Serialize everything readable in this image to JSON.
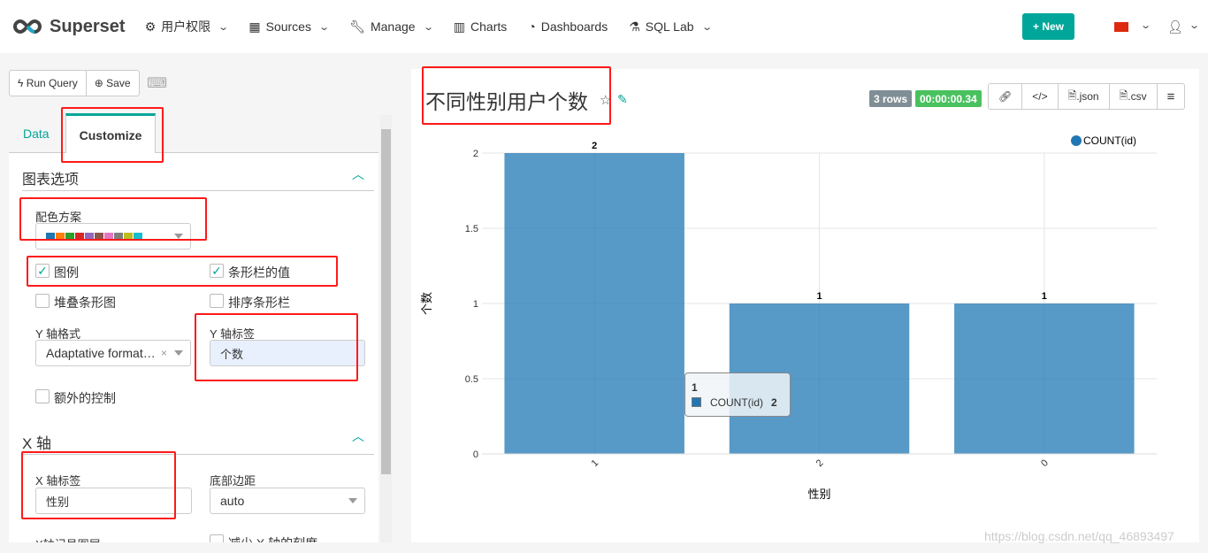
{
  "nav": {
    "brand": "Superset",
    "items": [
      {
        "label": "用户权限",
        "icon": "cogs-icon",
        "dropdown": true
      },
      {
        "label": "Sources",
        "icon": "table-icon",
        "dropdown": true
      },
      {
        "label": "Manage",
        "icon": "wrench-icon",
        "dropdown": true
      },
      {
        "label": "Charts",
        "icon": "bar-chart-icon",
        "dropdown": false
      },
      {
        "label": "Dashboards",
        "icon": "dashboard-icon",
        "dropdown": false
      },
      {
        "label": "SQL Lab",
        "icon": "flask-icon",
        "dropdown": true
      }
    ],
    "new_label": "New",
    "accent": "#00a699"
  },
  "toolbar": {
    "run_query": "Run Query",
    "save": "Save"
  },
  "tabs": [
    {
      "label": "Data",
      "active": false
    },
    {
      "label": "Customize",
      "active": true
    }
  ],
  "chart_options": {
    "title": "图表选项",
    "color_scheme_label": "配色方案",
    "color_scheme": [
      "#1f77b4",
      "#ff7f0e",
      "#2ca02c",
      "#d62728",
      "#9467bd",
      "#8c564b",
      "#e377c2",
      "#7f7f7f",
      "#bcbd22",
      "#17becf"
    ],
    "checkboxes": [
      {
        "label": "图例",
        "checked": true
      },
      {
        "label": "条形栏的值",
        "checked": true
      },
      {
        "label": "堆叠条形图",
        "checked": false
      },
      {
        "label": "排序条形栏",
        "checked": false
      }
    ],
    "y_format_label": "Y 轴格式",
    "y_format_value": "Adaptative format…",
    "y_label_label": "Y 轴标签",
    "y_label_value": "个数",
    "extra_controls": {
      "label": "额外的控制",
      "checked": false
    }
  },
  "x_axis": {
    "title": "X 轴",
    "x_label_label": "X 轴标签",
    "x_label_value": "性别",
    "bottom_margin_label": "底部边距",
    "bottom_margin_value": "auto",
    "cut_left": "X轴记号图层",
    "cut_right": "减少 X 轴的刻度"
  },
  "chart_header": {
    "title": "不同性别用户个数",
    "rows": "3 rows",
    "duration": "00:00:00.34",
    "tools": [
      ".json",
      ".csv"
    ]
  },
  "tooltip": {
    "title": "1",
    "series": "COUNT(id)",
    "value": "2"
  },
  "watermark": "https://blog.csdn.net/qq_46893497",
  "chart_data": {
    "type": "bar",
    "categories": [
      "1",
      "2",
      "0"
    ],
    "series": [
      {
        "name": "COUNT(id)",
        "values": [
          2,
          1,
          1
        ],
        "color": "#1f77b4"
      }
    ],
    "xlabel": "性别",
    "ylabel": "个数",
    "ylim": [
      0,
      2
    ],
    "yticks": [
      "0",
      "0.5",
      "1",
      "1.5",
      "2"
    ],
    "grid": true,
    "legend": "top-right",
    "show_values": true
  }
}
